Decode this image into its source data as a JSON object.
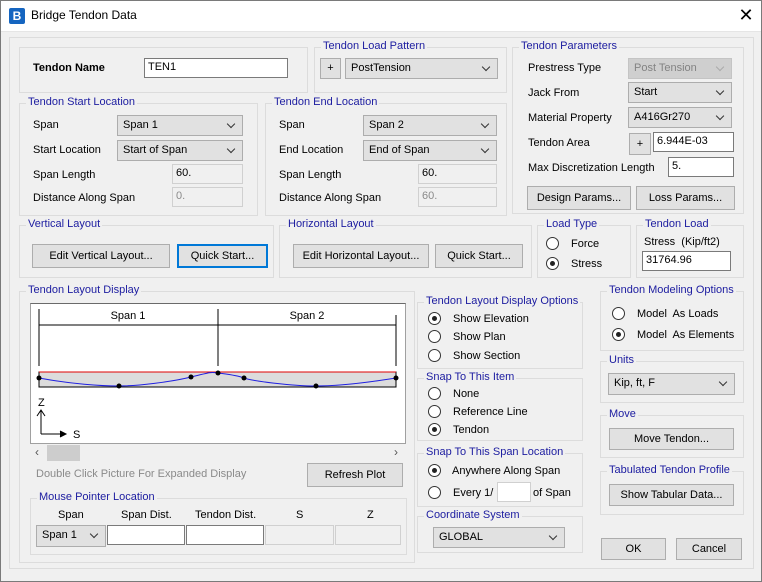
{
  "window": {
    "title": "Bridge Tendon Data",
    "app_icon": "B",
    "close": "✕"
  },
  "tendon_name": {
    "label": "Tendon Name",
    "value": "TEN1"
  },
  "load_pattern": {
    "legend": "Tendon Load Pattern",
    "plus": "+",
    "value": "PostTension"
  },
  "params": {
    "legend": "Tendon Parameters",
    "prestress_type_label": "Prestress Type",
    "prestress_type": "Post Tension",
    "jack_from_label": "Jack From",
    "jack_from": "Start",
    "material_label": "Material Property",
    "material": "A416Gr270",
    "area_label": "Tendon Area",
    "area_plus": "+",
    "area": "6.944E-03",
    "max_disc_label": "Max Discretization Length",
    "max_disc": "5.",
    "design_params": "Design Params...",
    "loss_params": "Loss Params..."
  },
  "start": {
    "legend": "Tendon Start Location",
    "span_label": "Span",
    "span": "Span 1",
    "loc_label": "Start Location",
    "loc": "Start of Span",
    "len_label": "Span Length",
    "len": "60.",
    "dist_label": "Distance Along Span",
    "dist": "0."
  },
  "end": {
    "legend": "Tendon End Location",
    "span_label": "Span",
    "span": "Span 2",
    "loc_label": "End Location",
    "loc": "End of Span",
    "len_label": "Span Length",
    "len": "60.",
    "dist_label": "Distance Along Span",
    "dist": "60."
  },
  "vertical": {
    "legend": "Vertical Layout",
    "edit": "Edit Vertical Layout...",
    "quick": "Quick Start..."
  },
  "horizontal": {
    "legend": "Horizontal Layout",
    "edit": "Edit Horizontal Layout...",
    "quick": "Quick Start..."
  },
  "load_type": {
    "legend": "Load Type",
    "force": "Force",
    "stress": "Stress",
    "selected": "Stress"
  },
  "tendon_load": {
    "legend": "Tendon Load",
    "label": "Stress  (Kip/ft2)",
    "value": "31764.96"
  },
  "display": {
    "legend": "Tendon Layout Display",
    "span1": "Span 1",
    "span2": "Span 2",
    "axis_z": "Z",
    "axis_s": "S",
    "hint": "Double Click Picture For Expanded Display",
    "refresh": "Refresh Plot",
    "colors": {
      "tendon": "#2020e0",
      "beam_top": "#e00000",
      "beam_fill": "#dcdcdc"
    }
  },
  "mouse": {
    "legend": "Mouse Pointer Location",
    "cols": [
      "Span",
      "Span Dist.",
      "Tendon Dist.",
      "S",
      "Z"
    ],
    "span": "Span 1",
    "span_dist": "",
    "tendon_dist": "",
    "s": "",
    "z": ""
  },
  "display_options": {
    "legend": "Tendon Layout Display Options",
    "items": [
      "Show Elevation",
      "Show Plan",
      "Show Section"
    ],
    "selected": "Show Elevation"
  },
  "snap_item": {
    "legend": "Snap To This Item",
    "items": [
      "None",
      "Reference Line",
      "Tendon"
    ],
    "selected": "Tendon"
  },
  "snap_span": {
    "legend": "Snap To This Span Location",
    "anywhere": "Anywhere Along Span",
    "every_prefix": "Every 1/",
    "every_value": "",
    "every_suffix": "of Span",
    "selected": "Anywhere Along Span"
  },
  "coord": {
    "legend": "Coordinate System",
    "value": "GLOBAL"
  },
  "modeling": {
    "legend": "Tendon Modeling Options",
    "loads": "Model  As Loads",
    "elements": "Model  As Elements",
    "selected": "Model  As Elements"
  },
  "units": {
    "legend": "Units",
    "value": "Kip, ft, F"
  },
  "move": {
    "legend": "Move",
    "button": "Move Tendon..."
  },
  "tabulated": {
    "legend": "Tabulated Tendon Profile",
    "button": "Show Tabular Data..."
  },
  "ok": "OK",
  "cancel": "Cancel"
}
